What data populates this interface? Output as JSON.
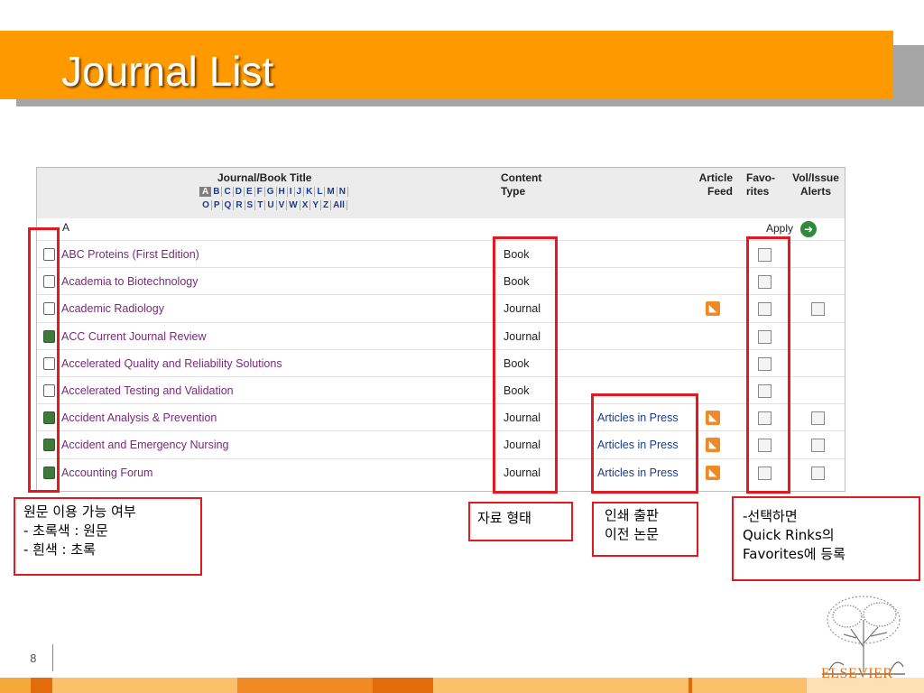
{
  "slide": {
    "title": "Journal List",
    "page_number": "8",
    "logo_text": "ELSEVIER"
  },
  "table": {
    "header_title": "Journal/Book Title",
    "header_content_1": "Content",
    "header_content_2": "Type",
    "header_feed_1": "Article",
    "header_feed_2": "Feed",
    "header_fav_1": "Favo-",
    "header_fav_2": "rites",
    "header_alerts_1": "Vol/Issue",
    "header_alerts_2": "Alerts",
    "letters_row1": [
      "A",
      "B",
      "C",
      "D",
      "E",
      "F",
      "G",
      "H",
      "I",
      "J",
      "K",
      "L",
      "M",
      "N"
    ],
    "letters_row2": [
      "O",
      "P",
      "Q",
      "R",
      "S",
      "T",
      "U",
      "V",
      "W",
      "X",
      "Y",
      "Z",
      "All"
    ],
    "section_letter": "A",
    "apply_label": "Apply",
    "rows": [
      {
        "title": "ABC Proteins (First Edition)",
        "type": "Book",
        "full_text": false,
        "press": "",
        "rss": false,
        "alerts": false
      },
      {
        "title": "Academia to Biotechnology",
        "type": "Book",
        "full_text": false,
        "press": "",
        "rss": false,
        "alerts": false
      },
      {
        "title": "Academic Radiology",
        "type": "Journal",
        "full_text": false,
        "press": "",
        "rss": true,
        "alerts": true
      },
      {
        "title": "ACC Current Journal Review",
        "type": "Journal",
        "full_text": true,
        "press": "",
        "rss": false,
        "alerts": false
      },
      {
        "title": "Accelerated Quality and Reliability Solutions",
        "type": "Book",
        "full_text": false,
        "press": "",
        "rss": false,
        "alerts": false
      },
      {
        "title": "Accelerated Testing and Validation",
        "type": "Book",
        "full_text": false,
        "press": "",
        "rss": false,
        "alerts": false
      },
      {
        "title": "Accident Analysis & Prevention",
        "type": "Journal",
        "full_text": true,
        "press": "Articles in Press",
        "rss": true,
        "alerts": true
      },
      {
        "title": "Accident and Emergency Nursing",
        "type": "Journal",
        "full_text": true,
        "press": "Articles in Press",
        "rss": true,
        "alerts": true
      },
      {
        "title": "Accounting Forum",
        "type": "Journal",
        "full_text": true,
        "press": "Articles in Press",
        "rss": true,
        "alerts": true
      }
    ]
  },
  "notes": {
    "availability": "원문 이용 가능 여부\n- 초록색 : 원문\n- 흰색 : 초록",
    "content_type": "자료 형태",
    "in_press": "인쇄 출판\n이전 논문",
    "favorites": "-선택하면\nQuick Rinks의\nFavorites에 등록"
  },
  "colors": {
    "title_bar": "#ff9900",
    "annotation_red": "#e6181f",
    "full_text_green": "#3f7a3a",
    "rss_orange": "#f08a24"
  },
  "icons": {
    "rss": "rss-feed-icon",
    "apply": "arrow-right-circle-icon",
    "logo": "elsevier-tree-logo"
  }
}
